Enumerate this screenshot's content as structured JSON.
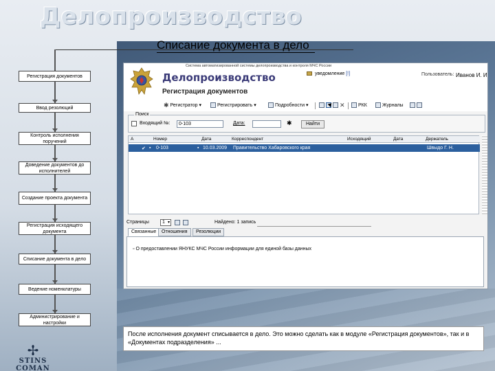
{
  "slide": {
    "section_title": "Делопроизводство",
    "title": "Списание документа в дело",
    "caption": "После исполнения документ списывается в дело. Это можно сделать как в модуле «Регистрация документов», так и в «Документах подразделения» ..."
  },
  "flow": {
    "steps": [
      "Регистрация документов",
      "Ввод резолюций",
      "Контроль исполнения поручений",
      "Доведение документов до исполнителей",
      "Создание проекта документа",
      "Регистрация исходящего документа",
      "Списание документа в дело",
      "Ведение номенклатуры",
      "Администрирование и настройки"
    ]
  },
  "logo": {
    "text": "STINS COMAN"
  },
  "app": {
    "system_title": "Система автоматизированной системы делопроизводства и контроля МЧС России",
    "name": "Делопроизводство",
    "module_title": "Регистрация документов",
    "notifications_label": "уведомление",
    "notifications_count": "[!]",
    "user_label": "Пользователь:",
    "user_name": "Иванов И. И.",
    "toolbar": {
      "register_label": "Регистратор",
      "register_doc_label": "Регистрировать",
      "details_label": "Подробности",
      "rkk_label": "РКК",
      "journals_label": "Журналы"
    },
    "search": {
      "legend": "Поиск",
      "incoming_label": "Входящий №:",
      "incoming_value": "0-103",
      "date_label": "Дата:",
      "date_value": "",
      "find_button": "Найти"
    },
    "grid": {
      "columns": [
        "А",
        "Номер",
        "Дата",
        "Корреспондент",
        "Исходящий",
        "Дата",
        "Держатель"
      ],
      "rows": [
        {
          "mark": "✔",
          "number": "0-103",
          "date": "10.03.2009",
          "correspondent": "Правительство Хабаровского края",
          "outgoing": "",
          "out_date": "",
          "holder": "Швыдо Г. Н."
        }
      ]
    },
    "pager": {
      "pages_label": "Страницы",
      "page_value": "1",
      "found_text": "Найдено: 1 запись"
    },
    "tabs": [
      "Связанные",
      "Отношения",
      "Резолюции"
    ],
    "tab_content": "О предоставлении ЯНУКС МЧС России информации для единой базы данных"
  }
}
